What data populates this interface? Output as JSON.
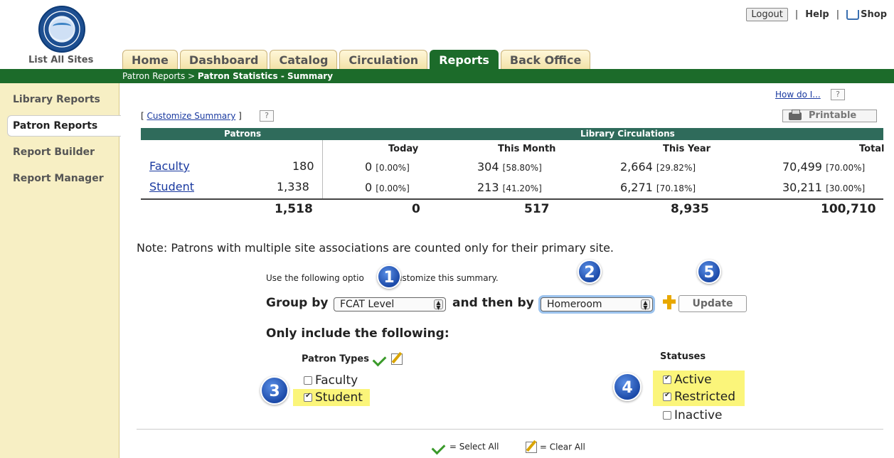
{
  "top": {
    "list_sites": "List All Sites",
    "logout": "Logout",
    "help": "Help",
    "shop": "Shop",
    "sep": "|"
  },
  "tabs": [
    "Home",
    "Dashboard",
    "Catalog",
    "Circulation",
    "Reports",
    "Back Office"
  ],
  "active_tab": "Reports",
  "breadcrumb": {
    "parent": "Patron Reports > ",
    "current": "Patron Statistics - Summary"
  },
  "sidebar": [
    "Library Reports",
    "Patron Reports",
    "Report Builder",
    "Report Manager"
  ],
  "howdo": "How do I...",
  "help_q": "?",
  "customize": {
    "open": "[ ",
    "label": "Customize Summary",
    "close": " ]"
  },
  "printable": "Printable",
  "table": {
    "patrons_header": "Patrons",
    "circ_header": "Library Circulations",
    "columns": [
      "Today",
      "This Month",
      "This Year",
      "Total"
    ],
    "rows": [
      {
        "name": "Faculty",
        "count": "180",
        "today": "0",
        "today_pct": "[0.00%]",
        "month": "304",
        "month_pct": "[58.80%]",
        "year": "2,664",
        "year_pct": "[29.82%]",
        "total": "70,499",
        "total_pct": "[70.00%]"
      },
      {
        "name": "Student",
        "count": "1,338",
        "today": "0",
        "today_pct": "[0.00%]",
        "month": "213",
        "month_pct": "[41.20%]",
        "year": "6,271",
        "year_pct": "[70.18%]",
        "total": "30,211",
        "total_pct": "[30.00%]"
      }
    ],
    "totals": {
      "count": "1,518",
      "today": "0",
      "month": "517",
      "year": "8,935",
      "total": "100,710"
    }
  },
  "note": "Note: Patrons with multiple site associations are counted only for their primary site.",
  "options": {
    "use_text_a": "Use the following optio",
    "use_text_b": "ustomize this summary.",
    "group_by": "Group by",
    "group_value": "FCAT Level",
    "then_by": "and then by",
    "then_value": "Homeroom",
    "update": "Update",
    "only_include": "Only include the following:",
    "patron_types_label": "Patron Types",
    "statuses_label": "Statuses",
    "patron_types": [
      {
        "label": "Faculty",
        "checked": false
      },
      {
        "label": "Student",
        "checked": true
      }
    ],
    "statuses": [
      {
        "label": "Active",
        "checked": true
      },
      {
        "label": "Restricted",
        "checked": true
      },
      {
        "label": "Inactive",
        "checked": false
      }
    ]
  },
  "badges": [
    "1",
    "2",
    "3",
    "4",
    "5"
  ],
  "legend": {
    "select_all": "= Select All",
    "clear_all": "= Clear All"
  },
  "colors": {
    "green": "#1c6b2a",
    "teal": "#2f6b5b",
    "tab": "#f3e2a8",
    "sidebar": "#f7efc4",
    "highlight": "#fbf57a",
    "badge": "#1c4aa8"
  }
}
